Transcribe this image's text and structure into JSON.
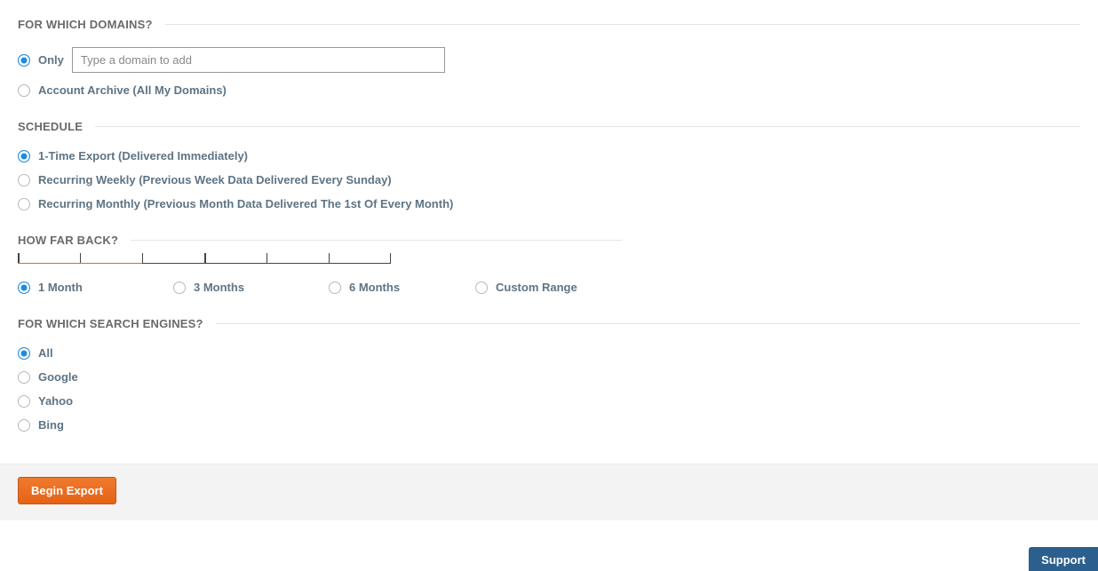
{
  "domains": {
    "legend": "FOR WHICH DOMAINS?",
    "only_label": "Only",
    "only_placeholder": "Type a domain to add",
    "archive_label": "Account Archive (All My Domains)"
  },
  "schedule": {
    "legend": "SCHEDULE",
    "one_time": "1-Time Export (Delivered Immediately)",
    "weekly": "Recurring Weekly (Previous Week Data Delivered Every Sunday)",
    "monthly": "Recurring Monthly (Previous Month Data Delivered The 1st Of Every Month)"
  },
  "howfar": {
    "legend": "HOW FAR BACK?",
    "m1": "1 Month",
    "m3": "3 Months",
    "m6": "6 Months",
    "custom": "Custom Range"
  },
  "engines": {
    "legend": "FOR WHICH SEARCH ENGINES?",
    "all": "All",
    "google": "Google",
    "yahoo": "Yahoo",
    "bing": "Bing"
  },
  "footer": {
    "begin": "Begin Export",
    "support": "Support"
  }
}
